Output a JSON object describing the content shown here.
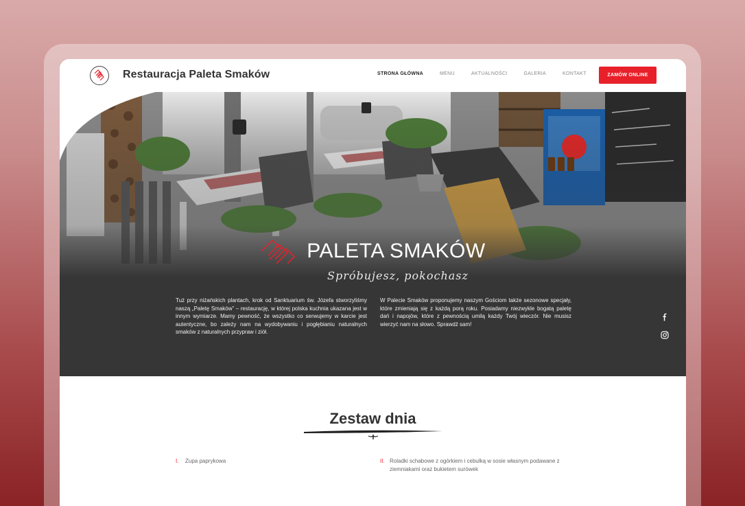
{
  "brand": {
    "name": "Restauracja Paleta Smaków"
  },
  "nav": {
    "items": [
      "STRONA GŁÓWNA",
      "MENU",
      "AKTUALNOŚCI",
      "GALERIA",
      "KONTAKT"
    ],
    "active": "STRONA GŁÓWNA"
  },
  "order_button": "ZAMÓW ONLINE",
  "hero": {
    "title": "PALETA SMAKÓW",
    "tagline": "Spróbujesz, pokochasz",
    "text_left": "Tuż przy niżańskich plantach, krok od Sanktuarium św. Józefa stworzyliśmy naszą „Paletę Smaków” – restaurację, w której polska kuchnia ukazana jest w innym wymiarze. Mamy pewność, że wszystko co serwujemy w karcie jest autentyczne, bo zależy nam na wydobywaniu i pogłębianiu naturalnych smaków z naturalnych przypraw i ziół.",
    "text_right": "W Palecie Smaków proponujemy naszym Gościom także sezonowe specjały, które zmieniają się z każdą porą roku. Posiadamy niezwykle bogatą paletę dań i napojów, które z pewnością umilą każdy Twój wieczór. Nie musisz wierzyć nam na słowo. Sprawdź sam!",
    "social": [
      "facebook-icon",
      "instagram-icon"
    ]
  },
  "daily_set": {
    "title": "Zestaw dnia",
    "items": [
      {
        "num": "I.",
        "text": "Zupa paprykowa"
      },
      {
        "num": "II.",
        "text": "Roladki schabowe z ogórkiem i cebulką w sosie własnym podawane z ziemniakami oraz bukietem surówek"
      }
    ]
  },
  "colors": {
    "accent": "#e8202a",
    "dark_panel": "#363636",
    "background_top": "#d9a9a9",
    "background_bottom": "#8a2325"
  }
}
